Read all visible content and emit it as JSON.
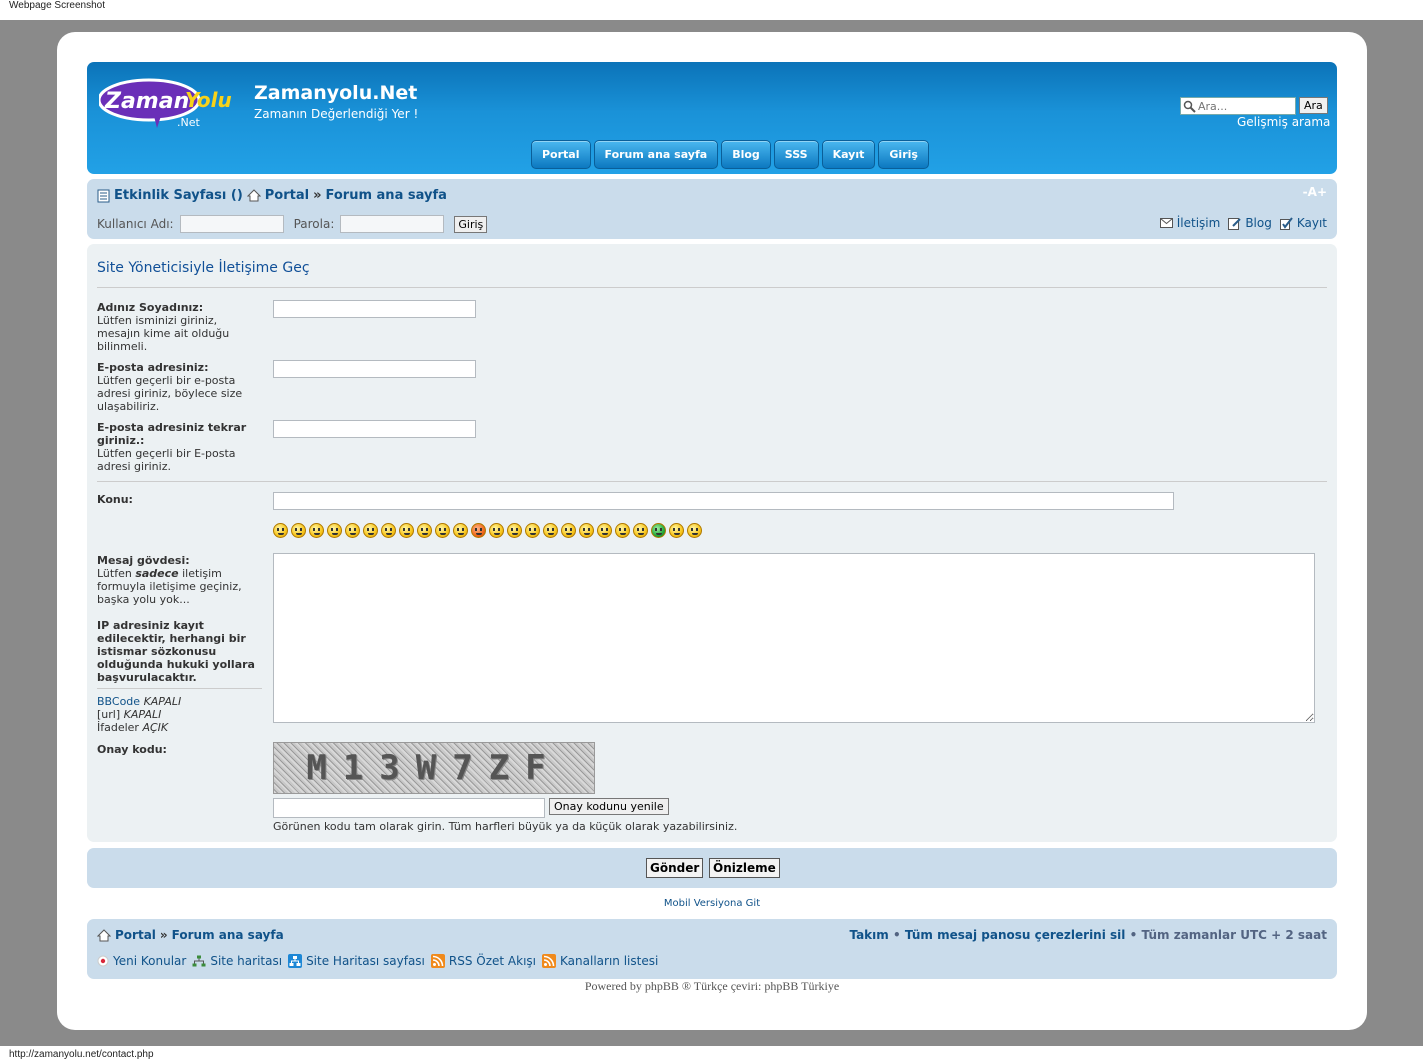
{
  "screenshot": {
    "caption": "Webpage Screenshot",
    "url": "http://zamanyolu.net/contact.php"
  },
  "header": {
    "logo_text": "ZamanYolu.Net",
    "site_title": "Zamanyolu.Net",
    "site_desc": "Zamanın Değerlendiği Yer !",
    "search_placeholder": "Ara...",
    "search_button": "Ara",
    "advanced_search": "Gelişmiş arama",
    "nav": [
      "Portal",
      "Forum ana sayfa",
      "Blog",
      "SSS",
      "Kayıt",
      "Giriş"
    ]
  },
  "breadcrumbs": {
    "items": [
      "Etkinlik Sayfası ()",
      "Portal",
      "Forum ana sayfa"
    ],
    "separator": "»",
    "font_size_controls": "-A+"
  },
  "login": {
    "username_label": "Kullanıcı Adı:",
    "password_label": "Parola:",
    "login_button": "Giriş"
  },
  "toplinks": [
    "İletişim",
    "Blog",
    "Kayıt"
  ],
  "form": {
    "title": "Site Yöneticisiyle İletişime Geç",
    "name_label": "Adınız Soyadınız:",
    "name_help": "Lütfen isminizi giriniz, mesajın kime ait olduğu bilinmeli.",
    "email_label": "E-posta adresiniz:",
    "email_help": "Lütfen geçerli bir e-posta adresi giriniz, böylece size ulaşabiliriz.",
    "email2_label": "E-posta adresiniz tekrar giriniz.:",
    "email2_help": "Lütfen geçerli bir E-posta adresi giriniz.",
    "subject_label": "Konu:",
    "body_label": "Mesaj gövdesi:",
    "body_help_pre": "Lütfen ",
    "body_help_em": "sadece",
    "body_help_post": " iletişim formuyla iletişime geçiniz, başka yolu yok...",
    "ip_warning": "IP adresiniz kayıt edilecektir, herhangi bir istismar sözkonusu olduğunda hukuki yollara başvurulacaktır.",
    "bbcode": "BBCode",
    "bbcode_state": "KAPALI",
    "url": "[url]",
    "url_state": "KAPALI",
    "smilies": "İfadeler",
    "smilies_state": "AÇIK",
    "captcha_label": "Onay kodu:",
    "captcha_text": "M13W7ZF",
    "captcha_refresh": "Onay kodunu yenile",
    "captcha_note": "Görünen kodu tam olarak girin. Tüm harfleri büyük ya da küçük olarak yazabilirsiniz.",
    "smiley_count": 24
  },
  "submit": {
    "send": "Gönder",
    "preview": "Önizleme"
  },
  "mobile_link": "Mobil Versiyona Git",
  "footer": {
    "crumbs": [
      "Portal",
      "Forum ana sayfa"
    ],
    "team": "Takım",
    "delete_cookies": "Tüm mesaj panosu çerezlerini sil",
    "timezone": "Tüm zamanlar UTC + 2 saat",
    "bullet": "•",
    "links": [
      "Yeni Konular",
      "Site haritası",
      "Site Haritası sayfası",
      "RSS Özet Akışı",
      "Kanalların listesi"
    ],
    "powered_pre": "Powered by ",
    "powered_phpbb": "phpBB",
    "powered_mid": " ® Türkçe çeviri: ",
    "powered_tr": "phpBB Türkiye"
  },
  "colors": {
    "header_blue": "#1a92d8",
    "bar_blue": "#cadceb",
    "panel": "#ecf1f3",
    "link": "#105289"
  }
}
